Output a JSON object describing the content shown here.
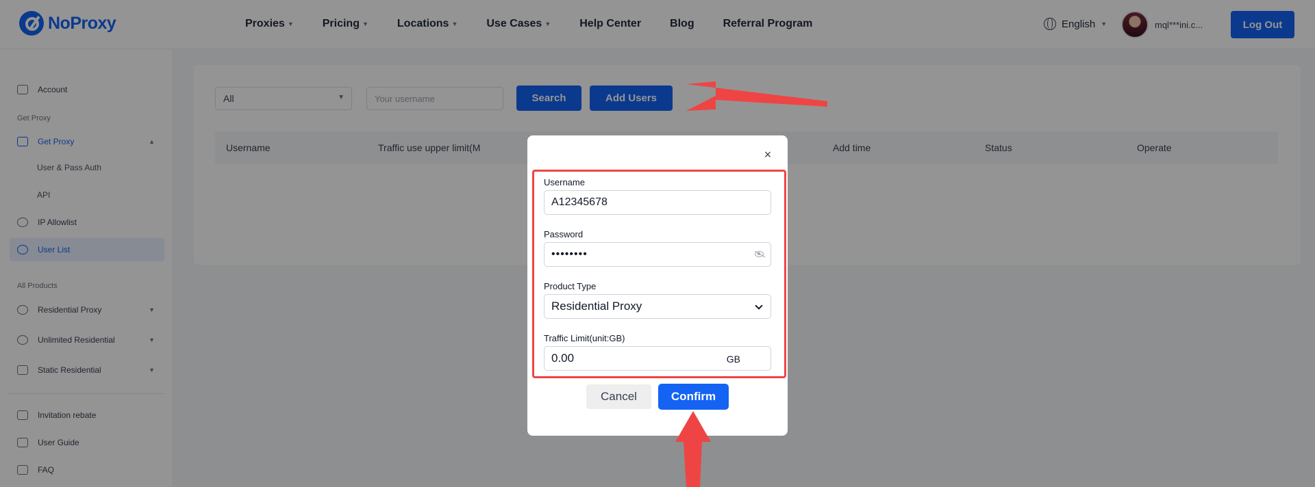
{
  "header": {
    "logo_text": "NoProxy",
    "nav": [
      "Proxies",
      "Pricing",
      "Locations",
      "Use Cases",
      "Help Center",
      "Blog",
      "Referral Program"
    ],
    "nav_dropdown": [
      true,
      true,
      true,
      true,
      false,
      false,
      false
    ],
    "language": "English",
    "user_email": "mql***ini.c...",
    "logout_label": "Log Out"
  },
  "sidebar": {
    "account": "Account",
    "group_get_proxy": "Get Proxy",
    "get_proxy": "Get Proxy",
    "user_pass_auth": "User & Pass Auth",
    "api": "API",
    "ip_allowlist": "IP Allowlist",
    "user_list": "User List",
    "group_all_products": "All Products",
    "residential_proxy": "Residential Proxy",
    "unlimited_residential": "Unlimited Residential",
    "static_residential": "Static Residential",
    "invitation_rebate": "Invitation rebate",
    "user_guide": "User Guide",
    "faq": "FAQ"
  },
  "filters": {
    "select_value": "All",
    "search_placeholder": "Your username",
    "search_label": "Search",
    "add_users_label": "Add Users"
  },
  "table": {
    "columns": [
      "Username",
      "Traffic use upper limit(M",
      "Add time",
      "Status",
      "Operate"
    ]
  },
  "modal": {
    "username_label": "Username",
    "username_value": "A12345678",
    "password_label": "Password",
    "password_value": "••••••••",
    "product_type_label": "Product Type",
    "product_type_value": "Residential Proxy",
    "traffic_limit_label": "Traffic Limit(unit:GB)",
    "traffic_limit_value": "0.00",
    "traffic_unit": "GB",
    "cancel_label": "Cancel",
    "confirm_label": "Confirm"
  },
  "colors": {
    "accent": "#1463f3",
    "highlight": "#ef4444"
  }
}
